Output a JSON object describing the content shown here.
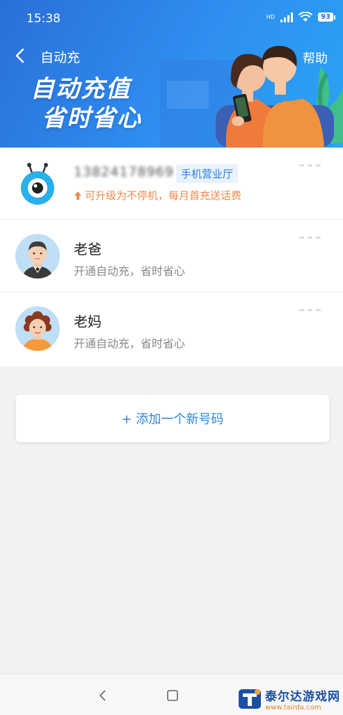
{
  "status_bar": {
    "time": "15:38",
    "battery": "93",
    "network": "HD"
  },
  "nav": {
    "title": "自动充",
    "help": "帮助"
  },
  "banner": {
    "line1": "自动充值",
    "line2": "省时省心"
  },
  "contacts": [
    {
      "number": "13824178969",
      "tag": "手机营业厅",
      "tip": "可升级为不停机，每月首充送话费"
    },
    {
      "name": "老爸",
      "subtitle": "开通自动充，省时省心"
    },
    {
      "name": "老妈",
      "subtitle": "开通自动充，省时省心"
    }
  ],
  "add_button": "+ 添加一个新号码",
  "watermark": {
    "title": "泰尔达游戏网",
    "url": "www.tairda.com"
  },
  "colors": {
    "primary": "#2f86d8",
    "header": "#2a6fd8",
    "tip": "#f08a4b"
  }
}
